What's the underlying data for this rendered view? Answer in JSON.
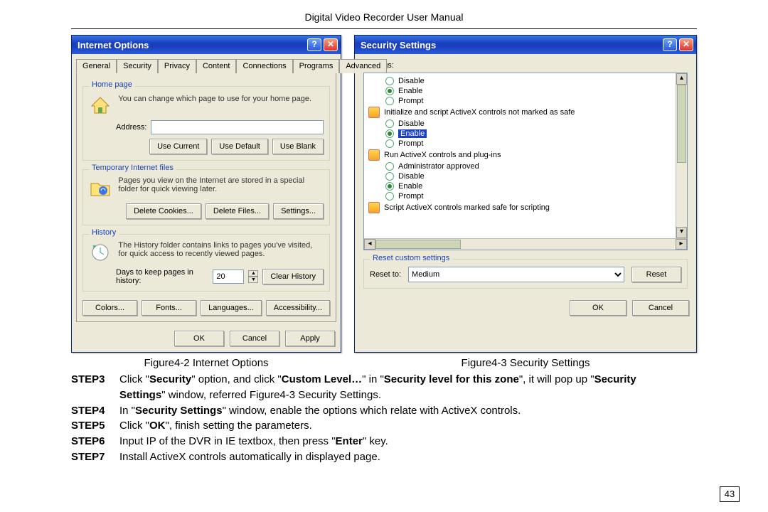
{
  "page": {
    "header": "Digital Video Recorder User Manual",
    "number": "43"
  },
  "io": {
    "title": "Internet Options",
    "tabs": [
      "General",
      "Security",
      "Privacy",
      "Content",
      "Connections",
      "Programs",
      "Advanced"
    ],
    "home": {
      "title": "Home page",
      "desc": "You can change which page to use for your home page.",
      "address_label": "Address:",
      "btn_current": "Use Current",
      "btn_default": "Use Default",
      "btn_blank": "Use Blank"
    },
    "temp": {
      "title": "Temporary Internet files",
      "desc": "Pages you view on the Internet are stored in a special folder for quick viewing later.",
      "btn_del_cookies": "Delete Cookies...",
      "btn_del_files": "Delete Files...",
      "btn_settings": "Settings..."
    },
    "hist": {
      "title": "History",
      "desc": "The History folder contains links to pages you've visited, for quick access to recently viewed pages.",
      "days_label": "Days to keep pages in history:",
      "days_value": "20",
      "btn_clear": "Clear History"
    },
    "bottom": {
      "colors": "Colors...",
      "fonts": "Fonts...",
      "languages": "Languages...",
      "access": "Accessibility..."
    },
    "ok": "OK",
    "cancel": "Cancel",
    "apply": "Apply"
  },
  "ss": {
    "title": "Security Settings",
    "settings_label": "Settings:",
    "items": {
      "g1": {
        "opt1": "Disable",
        "opt2": "Enable",
        "opt3": "Prompt"
      },
      "h2": "Initialize and script ActiveX controls not marked as safe",
      "g2": {
        "opt1": "Disable",
        "opt2": "Enable",
        "opt3": "Prompt"
      },
      "h3": "Run ActiveX controls and plug-ins",
      "g3": {
        "opt1": "Administrator approved",
        "opt2": "Disable",
        "opt3": "Enable",
        "opt4": "Prompt"
      },
      "h4": "Script ActiveX controls marked safe for scripting"
    },
    "reset": {
      "title": "Reset custom settings",
      "label": "Reset to:",
      "value": "Medium",
      "btn": "Reset"
    },
    "ok": "OK",
    "cancel": "Cancel"
  },
  "captions": {
    "io": "Figure4-2 Internet Options",
    "ss": "Figure4-3 Security Settings"
  },
  "steps": {
    "s3_label": "STEP3",
    "s3_text": "Click \"Security\" option, and click \"Custom Level…\" in \"Security level for this zone\", it will pop up \"Security Settings\" window, referred Figure4-3 Security Settings.",
    "s4_label": "STEP4",
    "s4_text": "In \"Security Settings\" window, enable the options which relate with ActiveX controls.",
    "s5_label": "STEP5",
    "s5_text": "Click \"OK\", finish setting the parameters.",
    "s6_label": "STEP6",
    "s6_text": "Input IP of the DVR in IE textbox, then press \"Enter\" key.",
    "s7_label": "STEP7",
    "s7_text": "Install ActiveX controls automatically in displayed page."
  }
}
